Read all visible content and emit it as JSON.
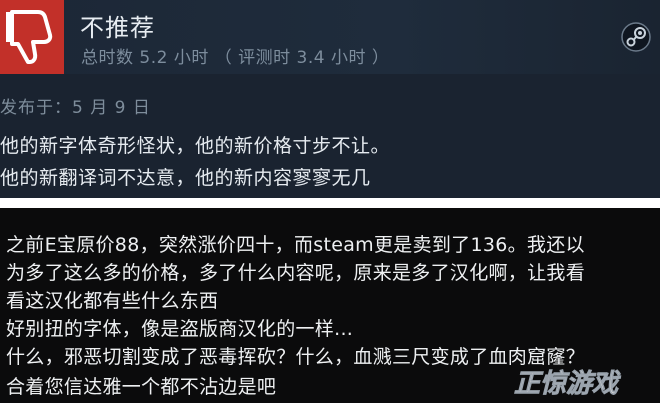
{
  "review": {
    "verdict": "不推荐",
    "hours_text": "总时数 5.2 小时 （ 评测时 3.4 小时 ）",
    "posted": "发布于：5 月 9 日",
    "body_lines": [
      "他的新字体奇形怪状，他的新价格寸步不让。",
      "他的新翻译词不达意，他的新内容寥寥无几"
    ],
    "icons": {
      "thumb": "thumbs-down-icon",
      "platform": "steam-icon"
    },
    "colors": {
      "thumb_bg": "#c23029",
      "card_bg": "#1a2330"
    }
  },
  "comment": {
    "lines": [
      "之前E宝原价88，突然涨价四十，而steam更是卖到了136。我还以",
      "为多了这么多的价格，多了什么内容呢，原来是多了汉化啊，让我看",
      "看这汉化都有些什么东西",
      "好别扭的字体，像是盗版商汉化的一样...",
      "什么，邪恶切割变成了恶毒挥砍？什么，血溅三尺变成了血肉窟窿？",
      "合着您信达雅一个都不沾边是吧"
    ]
  },
  "watermark": {
    "text": "正惊游戏"
  }
}
